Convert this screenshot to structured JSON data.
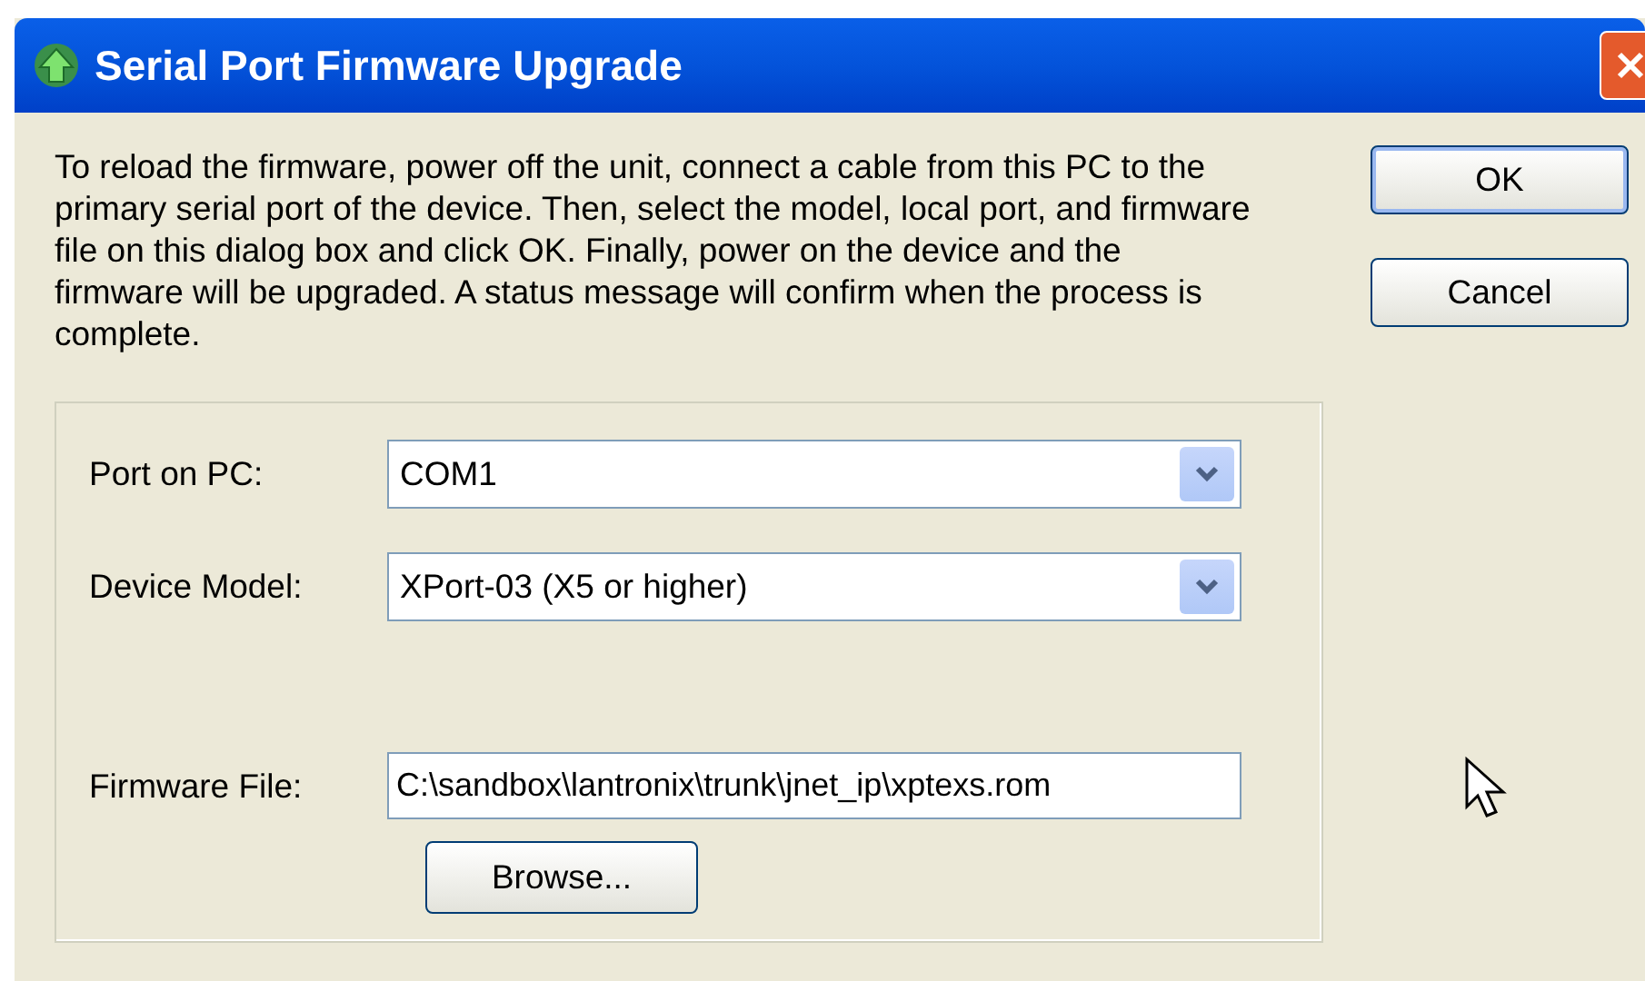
{
  "window": {
    "title": "Serial Port Firmware Upgrade"
  },
  "instructions": "To reload the firmware, power off the unit, connect a cable from this PC to the primary serial port of the device.  Then, select the model, local port, and firmware file on this dialog box and click OK.  Finally, power on the device and the firmware will be upgraded.  A status message will confirm when the process is complete.",
  "fields": [
    {
      "kind": "dropdown",
      "label": "Port on PC:",
      "value": "COM1"
    },
    {
      "kind": "dropdown",
      "label": "Device Model:",
      "value": "XPort-03 (X5 or higher)"
    },
    {
      "kind": "file",
      "label": "Firmware File:",
      "value": "C:\\sandbox\\lantronix\\trunk\\jnet_ip\\xptexs.rom",
      "button": "Browse..."
    }
  ],
  "buttons": [
    {
      "label": "OK",
      "default": true
    },
    {
      "label": "Cancel",
      "default": false
    }
  ]
}
